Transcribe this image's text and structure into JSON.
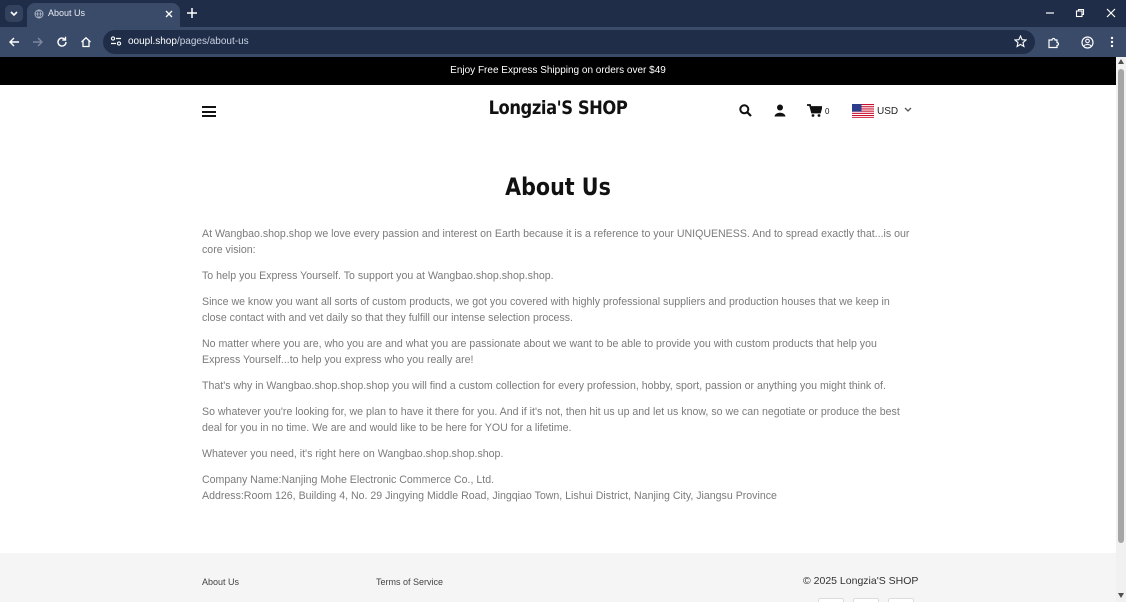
{
  "browser": {
    "tab_title": "About Us",
    "url_host": "ooupl.shop",
    "url_path": "/pages/about-us"
  },
  "announcement": "Enjoy Free Express Shipping on orders over $49",
  "header": {
    "logo": "Longzia'S SHOP",
    "cart_count": "0",
    "currency": "USD"
  },
  "page": {
    "title": "About Us",
    "paragraphs": [
      "At Wangbao.shop.shop we love every passion and interest on Earth because it is a reference to your UNIQUENESS. And to spread exactly that...is our core vision:",
      "To help you Express Yourself. To support you at Wangbao.shop.shop.shop.",
      "Since we know you want all sorts of custom products, we got you covered with highly professional suppliers and production houses that we keep in close contact with and vet daily so that they fulfill our intense selection process.",
      "No matter where you are, who you are and what you are passionate about we want to be able to provide you with custom products that help you Express Yourself...to help you express who you really are!",
      "That's why in Wangbao.shop.shop.shop you will find a custom collection for every profession, hobby, sport, passion or anything you might think of.",
      "So whatever you're looking for, we plan to have it there for you. And if it's not, then hit us up and let us know, so we can negotiate or produce the best deal for you in no time. We are and would like to be here for YOU for a lifetime.",
      "Whatever you need, it's right here on Wangbao.shop.shop.shop."
    ],
    "company_name": "Company Name:Nanjing Mohe Electronic Commerce Co., Ltd.",
    "address": "Address:Room 126, Building 4, No. 29 Jingying Middle Road, Jingqiao Town, Lishui District, Nanjing City, Jiangsu Province"
  },
  "footer": {
    "link_about": "About Us",
    "link_terms": "Terms of Service",
    "copyright": "© 2025 Longzia'S SHOP"
  },
  "colors": {
    "chrome_dark": "#1f2d49",
    "chrome_mid": "#3a4a69",
    "announce_bg": "#000000",
    "body_text": "#7b7b7b"
  }
}
